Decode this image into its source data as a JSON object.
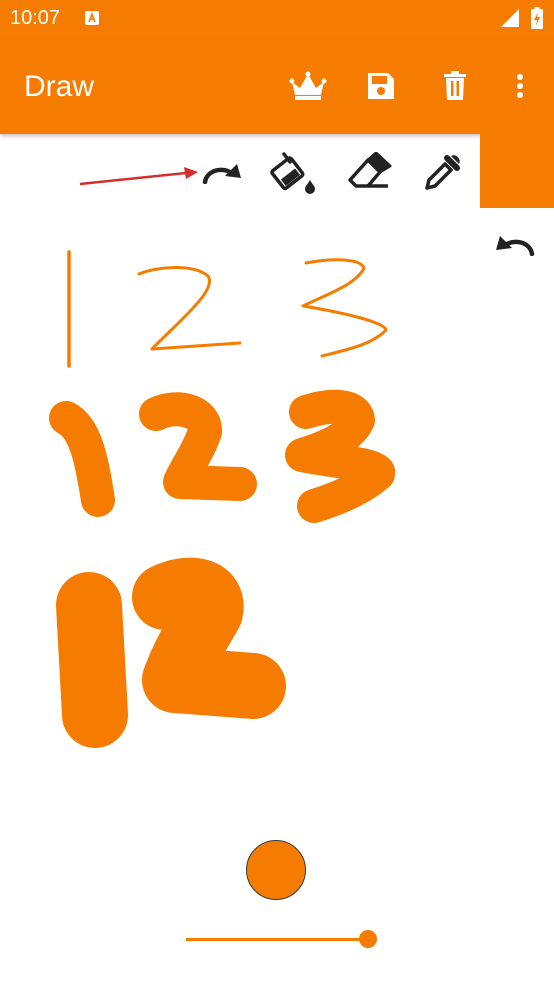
{
  "status_bar": {
    "time": "10:07"
  },
  "app_bar": {
    "title": "Draw"
  },
  "toolbar": {
    "actions": [
      "crown-icon",
      "save-icon",
      "delete-icon",
      "more-vert-icon"
    ],
    "tools": [
      "redo-icon",
      "fill-icon",
      "eraser-icon",
      "color-picker-icon"
    ],
    "undo": "undo-icon"
  },
  "brush": {
    "color": "#f57c00",
    "size_level": 0.91
  },
  "colors": {
    "accent": "#f57c00",
    "annotation_arrow": "#d32f2f"
  }
}
